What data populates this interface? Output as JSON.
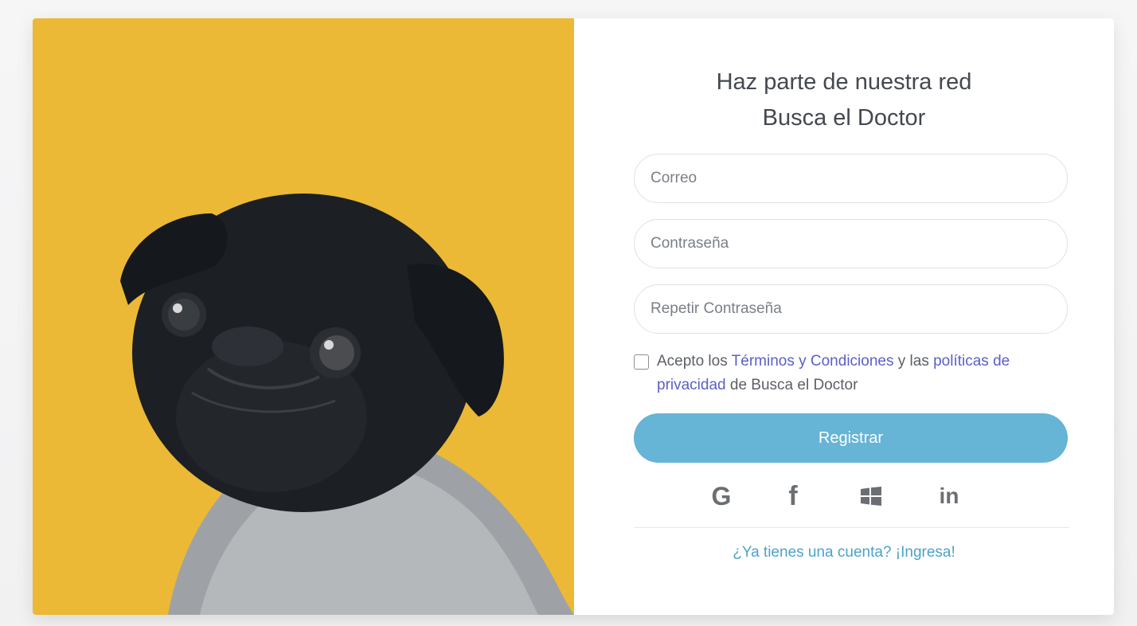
{
  "heading": {
    "line1": "Haz parte de nuestra red",
    "line2": "Busca el Doctor"
  },
  "form": {
    "email_placeholder": "Correo",
    "password_placeholder": "Contraseña",
    "repeat_password_placeholder": "Repetir Contraseña",
    "terms": {
      "prefix": "Acepto los ",
      "terms_link": "Términos y Condiciones",
      "middle": " y las ",
      "privacy_link": "políticas de privacidad",
      "suffix": " de Busca el Doctor"
    },
    "submit_label": "Registrar"
  },
  "social": {
    "google_label": "G",
    "facebook_label": "f",
    "linkedin_label": "in"
  },
  "login_link": "¿Ya tienes una cuenta? ¡Ingresa!",
  "colors": {
    "photo_background": "#ebb936",
    "button": "#66b4d6",
    "link": "#5b5fc7",
    "login_link": "#4ba3c9"
  }
}
